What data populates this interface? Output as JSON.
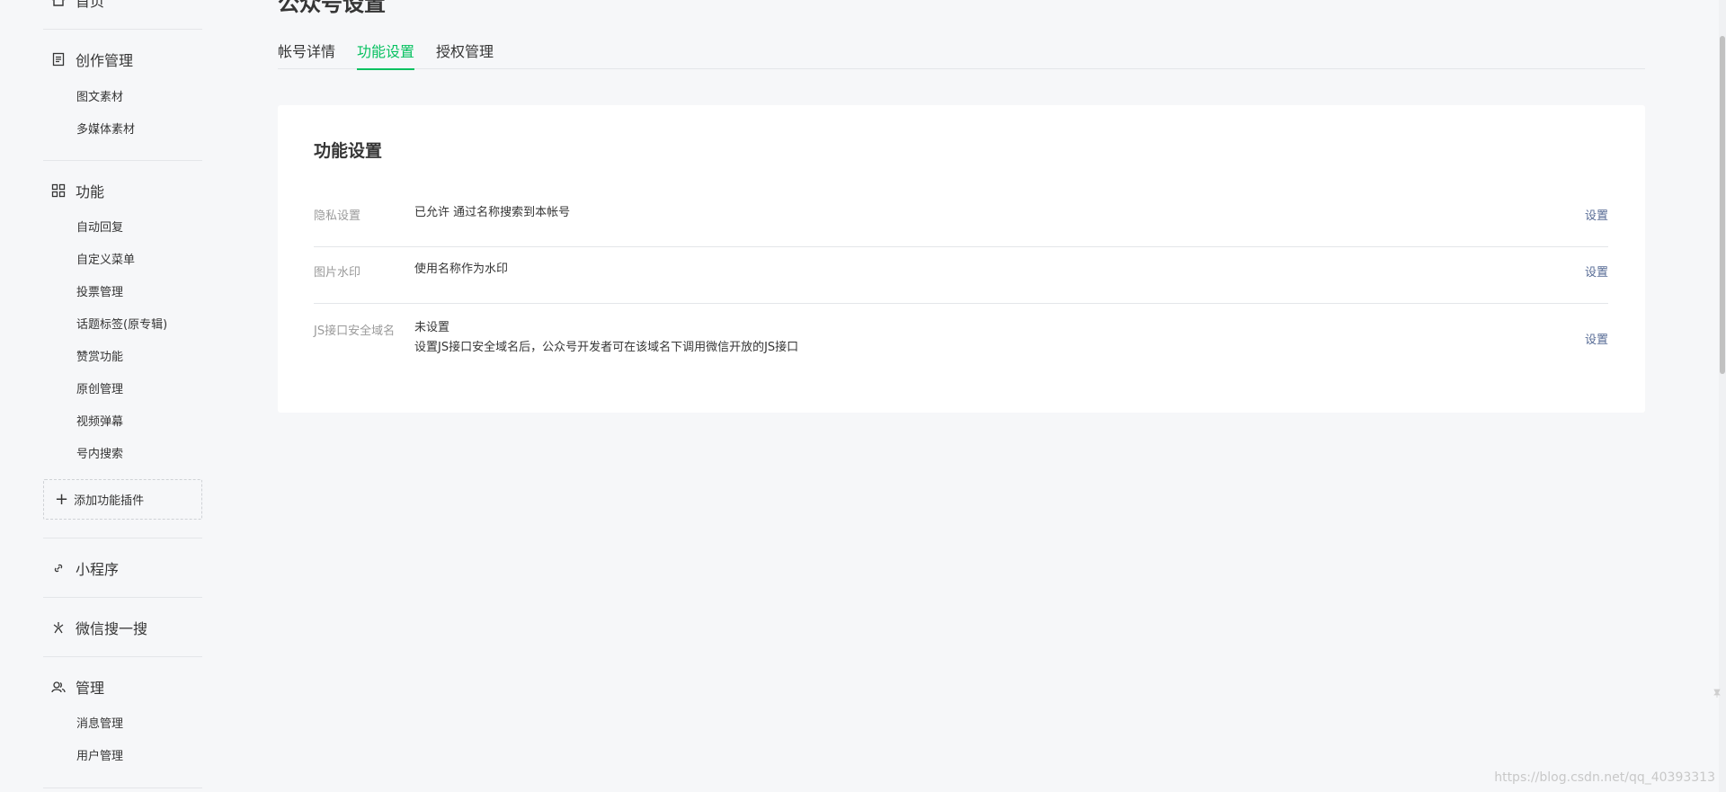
{
  "sidebar": {
    "home": {
      "label": "首页",
      "icon": "home-icon"
    },
    "creation": {
      "label": "创作管理",
      "icon": "document-icon",
      "items": [
        {
          "label": "图文素材"
        },
        {
          "label": "多媒体素材"
        }
      ]
    },
    "features": {
      "label": "功能",
      "icon": "grid-icon",
      "items": [
        {
          "label": "自动回复"
        },
        {
          "label": "自定义菜单"
        },
        {
          "label": "投票管理"
        },
        {
          "label": "话题标签(原专辑)"
        },
        {
          "label": "赞赏功能"
        },
        {
          "label": "原创管理"
        },
        {
          "label": "视频弹幕"
        },
        {
          "label": "号内搜索"
        }
      ],
      "add_plugin_label": "添加功能插件"
    },
    "mini_program": {
      "label": "小程序",
      "icon": "link-icon"
    },
    "wechat_search": {
      "label": "微信搜一搜",
      "icon": "search-star-icon"
    },
    "management": {
      "label": "管理",
      "icon": "users-icon",
      "items": [
        {
          "label": "消息管理"
        },
        {
          "label": "用户管理"
        }
      ]
    }
  },
  "header": {
    "title": "公众号设置",
    "tabs": [
      {
        "label": "帐号详情",
        "active": false
      },
      {
        "label": "功能设置",
        "active": true
      },
      {
        "label": "授权管理",
        "active": false
      }
    ]
  },
  "card": {
    "title": "功能设置",
    "rows": [
      {
        "label": "隐私设置",
        "value": "已允许 通过名称搜索到本帐号",
        "action": "设置"
      },
      {
        "label": "图片水印",
        "value": "使用名称作为水印",
        "action": "设置"
      },
      {
        "label": "JS接口安全域名",
        "value": "未设置",
        "sub_value": "设置JS接口安全域名后，公众号开发者可在该域名下调用微信开放的JS接口",
        "action": "设置"
      }
    ]
  },
  "watermark": "https://blog.csdn.net/qq_40393313",
  "colors": {
    "accent": "#07c160",
    "link": "#576b95",
    "muted": "#9a9a9a",
    "background": "#f6f7f9"
  }
}
